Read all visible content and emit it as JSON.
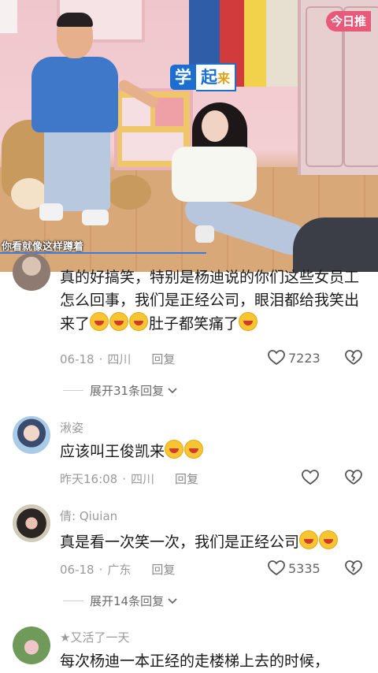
{
  "video": {
    "brand_badge": "今日推",
    "title_tag": {
      "word1": "学",
      "word2": "起",
      "word3": "来"
    },
    "subtitle": "你看就像这样蹲着"
  },
  "comments": [
    {
      "id": 1,
      "text": "真的好搞笑，特别是杨迪说的你们这些女员工怎么回事，我们是正经公司，眼泪都给我笑出来了",
      "text_tail": "肚子都笑痛了",
      "emoji": "laughing-emoji",
      "date": "06-18",
      "location": "四川",
      "reply_label": "回复",
      "likes": "7223",
      "expand_label": "展开31条回复"
    },
    {
      "id": 2,
      "username": "湫姿",
      "text": "应该叫王俊凯来",
      "emoji": "grin-emoji",
      "date": "昨天16:08",
      "location": "四川",
      "reply_label": "回复",
      "likes": ""
    },
    {
      "id": 3,
      "username": "倩: Qiuian",
      "text": "真是看一次笑一次，我们是正经公司",
      "emoji": "grin-emoji",
      "date": "06-18",
      "location": "广东",
      "reply_label": "回复",
      "likes": "5335",
      "expand_label": "展开14条回复"
    },
    {
      "id": 4,
      "username": "★又活了一天",
      "text": "每次杨迪一本正经的走楼梯上去的时候，"
    }
  ],
  "colors": {
    "accent_blue": "#1c6fd1",
    "brand_pink": "#e85a7a",
    "meta_gray": "#9a9a9a"
  }
}
